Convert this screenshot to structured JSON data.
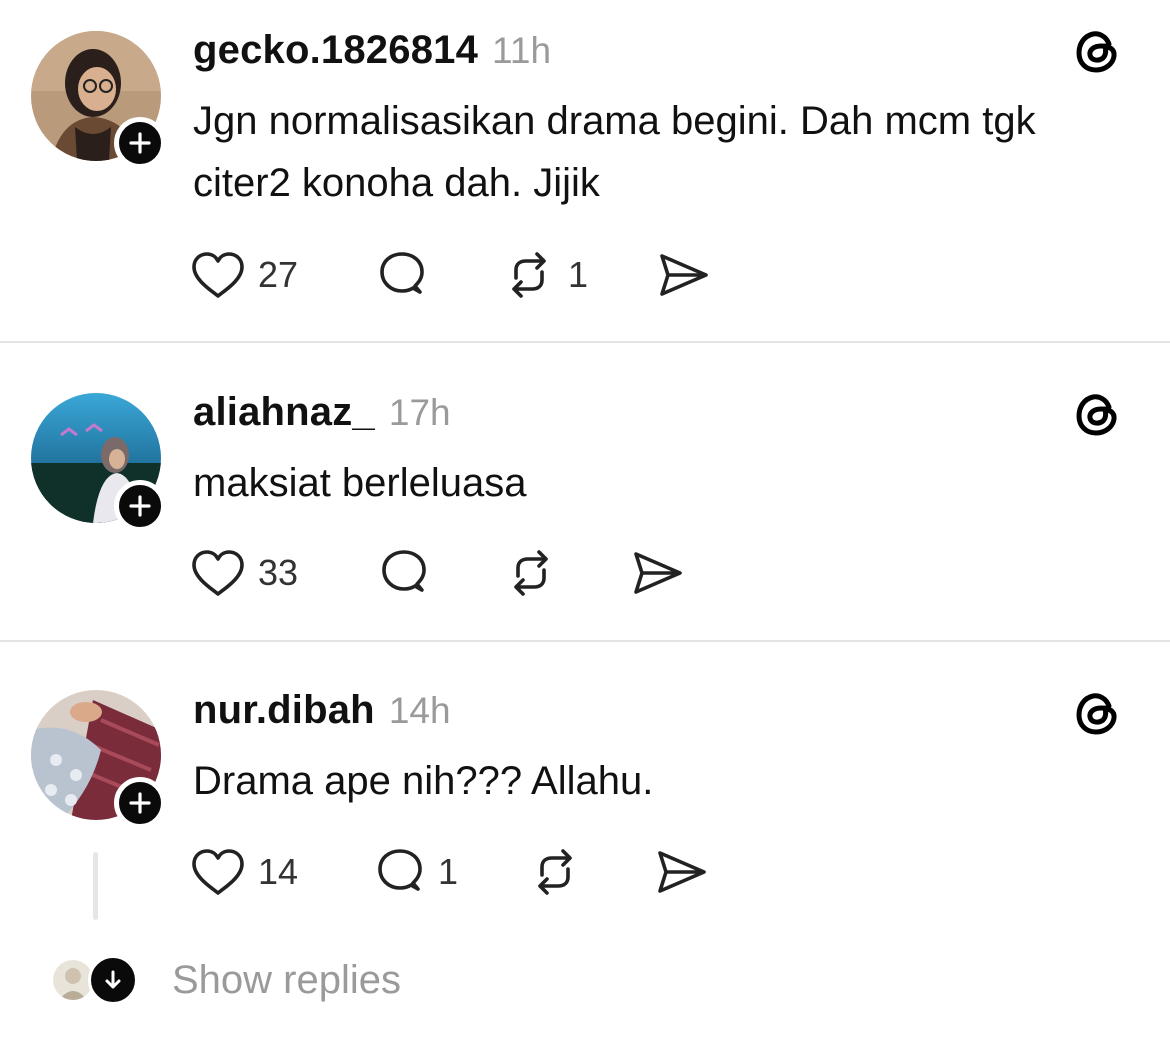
{
  "posts": [
    {
      "username": "gecko.1826814",
      "time": "11h",
      "text": "Jgn normalisasikan drama begini. Dah mcm tgk citer2 konoha dah. Jijik",
      "likes": "27",
      "replies": "",
      "reposts": "1"
    },
    {
      "username": "aliahnaz_",
      "time": "17h",
      "text": "maksiat berleluasa",
      "likes": "33",
      "replies": "",
      "reposts": ""
    },
    {
      "username": "nur.dibah",
      "time": "14h",
      "text": "Drama ape nih??? Allahu.",
      "likes": "14",
      "replies": "1",
      "reposts": ""
    }
  ],
  "show_replies_label": "Show replies",
  "icons": {
    "follow": "plus-icon",
    "threads": "threads-logo-icon",
    "like": "heart-icon",
    "reply": "comment-bubble-icon",
    "repost": "repost-icon",
    "share": "send-icon",
    "expand": "arrow-down-icon"
  }
}
